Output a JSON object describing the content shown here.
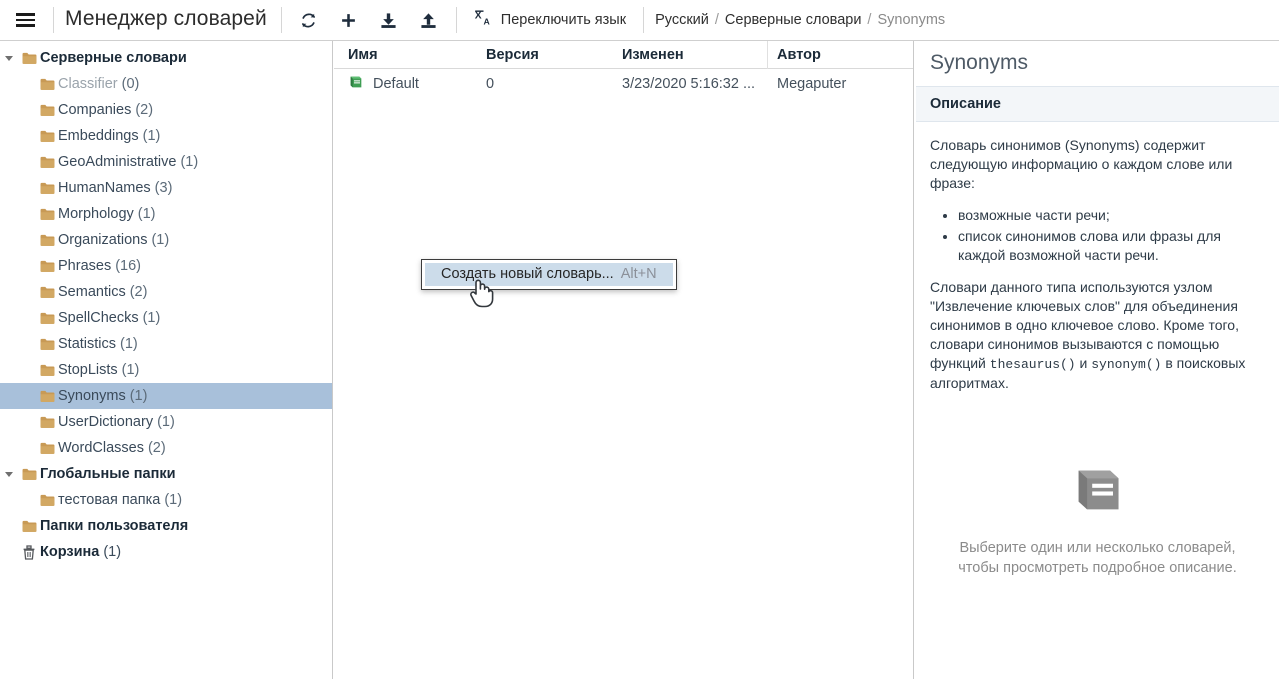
{
  "header": {
    "menu_icon": "hamburger-icon",
    "title": "Менеджер словарей",
    "tools": [
      {
        "name": "refresh-button",
        "icon": "refresh-icon"
      },
      {
        "name": "add-button",
        "icon": "plus-icon"
      },
      {
        "name": "import-button",
        "icon": "download-icon"
      },
      {
        "name": "export-button",
        "icon": "upload-icon"
      }
    ],
    "lang_button": {
      "icon": "translate-icon",
      "label": "Переключить язык"
    },
    "breadcrumbs": [
      {
        "label": "Русский",
        "current": false
      },
      {
        "label": "Серверные словари",
        "current": false
      },
      {
        "label": "Synonyms",
        "current": true
      }
    ],
    "separator": "/"
  },
  "sidebar": {
    "items": [
      {
        "label": "Серверные словари",
        "count": "",
        "level": 0,
        "bold": true,
        "twisty": true,
        "icon": "folder-icon",
        "selected": false,
        "dim": false
      },
      {
        "label": "Classifier",
        "count": "(0)",
        "level": 1,
        "bold": false,
        "twisty": false,
        "icon": "folder-icon",
        "selected": false,
        "dim": true
      },
      {
        "label": "Companies",
        "count": "(2)",
        "level": 1,
        "bold": false,
        "twisty": false,
        "icon": "folder-icon",
        "selected": false,
        "dim": false
      },
      {
        "label": "Embeddings",
        "count": "(1)",
        "level": 1,
        "bold": false,
        "twisty": false,
        "icon": "folder-icon",
        "selected": false,
        "dim": false
      },
      {
        "label": "GeoAdministrative",
        "count": "(1)",
        "level": 1,
        "bold": false,
        "twisty": false,
        "icon": "folder-icon",
        "selected": false,
        "dim": false
      },
      {
        "label": "HumanNames",
        "count": "(3)",
        "level": 1,
        "bold": false,
        "twisty": false,
        "icon": "folder-icon",
        "selected": false,
        "dim": false
      },
      {
        "label": "Morphology",
        "count": "(1)",
        "level": 1,
        "bold": false,
        "twisty": false,
        "icon": "folder-icon",
        "selected": false,
        "dim": false
      },
      {
        "label": "Organizations",
        "count": "(1)",
        "level": 1,
        "bold": false,
        "twisty": false,
        "icon": "folder-icon",
        "selected": false,
        "dim": false
      },
      {
        "label": "Phrases",
        "count": "(16)",
        "level": 1,
        "bold": false,
        "twisty": false,
        "icon": "folder-icon",
        "selected": false,
        "dim": false
      },
      {
        "label": "Semantics",
        "count": "(2)",
        "level": 1,
        "bold": false,
        "twisty": false,
        "icon": "folder-icon",
        "selected": false,
        "dim": false
      },
      {
        "label": "SpellChecks",
        "count": "(1)",
        "level": 1,
        "bold": false,
        "twisty": false,
        "icon": "folder-icon",
        "selected": false,
        "dim": false
      },
      {
        "label": "Statistics",
        "count": "(1)",
        "level": 1,
        "bold": false,
        "twisty": false,
        "icon": "folder-icon",
        "selected": false,
        "dim": false
      },
      {
        "label": "StopLists",
        "count": "(1)",
        "level": 1,
        "bold": false,
        "twisty": false,
        "icon": "folder-icon",
        "selected": false,
        "dim": false
      },
      {
        "label": "Synonyms",
        "count": "(1)",
        "level": 1,
        "bold": false,
        "twisty": false,
        "icon": "folder-icon",
        "selected": true,
        "dim": false
      },
      {
        "label": "UserDictionary",
        "count": "(1)",
        "level": 1,
        "bold": false,
        "twisty": false,
        "icon": "folder-icon",
        "selected": false,
        "dim": false
      },
      {
        "label": "WordClasses",
        "count": "(2)",
        "level": 1,
        "bold": false,
        "twisty": false,
        "icon": "folder-icon",
        "selected": false,
        "dim": false
      },
      {
        "label": "Глобальные папки",
        "count": "",
        "level": 0,
        "bold": true,
        "twisty": true,
        "icon": "folder-icon",
        "selected": false,
        "dim": false
      },
      {
        "label": "тестовая папка",
        "count": "(1)",
        "level": 1,
        "bold": false,
        "twisty": false,
        "icon": "folder-icon",
        "selected": false,
        "dim": false
      },
      {
        "label": "Папки пользователя",
        "count": "",
        "level": 0,
        "bold": true,
        "twisty": false,
        "icon": "folder-icon",
        "selected": false,
        "dim": false
      },
      {
        "label": "Корзина",
        "count": "(1)",
        "level": 0,
        "bold": true,
        "twisty": false,
        "icon": "trash-icon",
        "selected": false,
        "dim": false
      }
    ]
  },
  "list": {
    "columns": [
      "Имя",
      "Версия",
      "Изменен",
      "Автор"
    ],
    "rows": [
      {
        "icon": "book-icon",
        "name": "Default",
        "version": "0",
        "modified": "3/23/2020 5:16:32 ...",
        "author": "Megaputer"
      }
    ]
  },
  "context_menu": {
    "items": [
      {
        "label": "Создать новый словарь...",
        "shortcut": "Alt+N",
        "highlighted": true
      }
    ]
  },
  "details": {
    "title": "Synonyms",
    "section_label": "Описание",
    "intro": "Словарь синонимов (Synonyms) содержит следующую информацию о каждом слове или фразе:",
    "bullets": [
      "возможные части речи;",
      "список синонимов слова или фразы для каждой возможной части речи."
    ],
    "para_before_code": "Словари данного типа используются узлом \"Извлечение ключевых слов\" для объединения синонимов в одно ключевое слово. Кроме того, словари синонимов вызываются с помощью функций ",
    "code_1": "thesaurus()",
    "para_mid_code": " и ",
    "code_2": "synonym()",
    "para_after_code": " в поисковых алгоритмах.",
    "empty_icon": "book-placeholder-icon",
    "empty_text": "Выберите один или несколько словарей, чтобы просмотреть подробное описание."
  },
  "colors": {
    "selection": "#a8c0da",
    "folder": "#c89a55",
    "book_green": "#3f9e54",
    "menu_highlight": "#ccdcea",
    "section_bg": "#f3f6f9"
  }
}
